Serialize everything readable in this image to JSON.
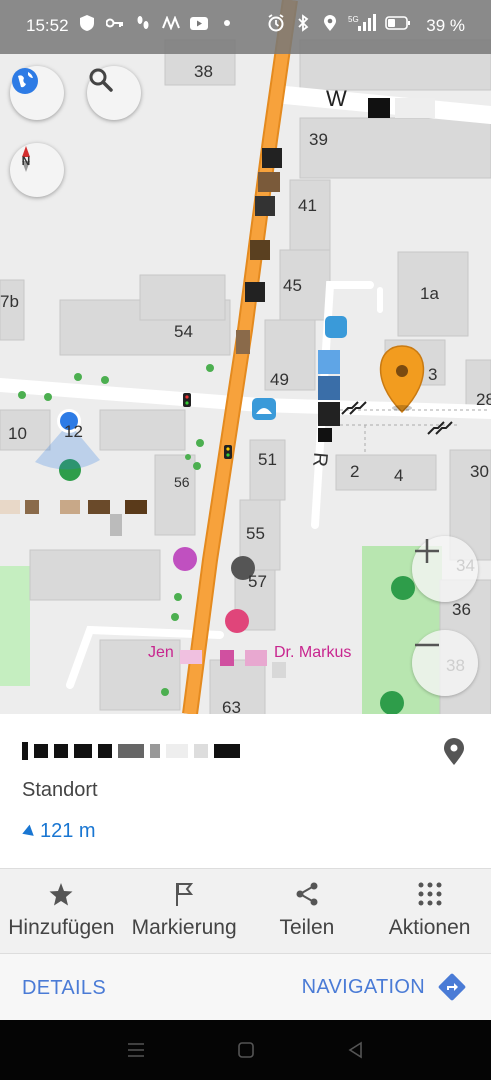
{
  "status_bar": {
    "time": "15:52",
    "battery_percent": "39 %",
    "network": "5G",
    "left_icons": [
      "shield-icon",
      "key-icon",
      "footsteps-icon",
      "wave-icon",
      "youtube-icon",
      "dot-icon"
    ],
    "right_icons": [
      "alarm-icon",
      "bluetooth-icon",
      "location-icon",
      "signal-icon",
      "battery-icon"
    ]
  },
  "map": {
    "building_numbers": [
      "38",
      "39",
      "41",
      "45",
      "54",
      "49",
      "1a",
      "3",
      "28",
      "7b",
      "10",
      "12",
      "51",
      "56",
      "2",
      "4",
      "30",
      "34",
      "55",
      "57",
      "36",
      "38",
      "63"
    ],
    "street_label_partial": "W",
    "street_label_vertical": "R",
    "poi_label_partial": "Jen",
    "poi_label_partial_2": "Dr. Markus",
    "colors": {
      "main_road": "#f7a23c",
      "background": "#ededed",
      "building": "#d9d9d9",
      "park": "#b8e6b0",
      "marker": "#f29c1f",
      "location_dot": "#2d7be5"
    }
  },
  "controls": {
    "layers_icon": "globe-icon",
    "search_icon": "search-icon",
    "compass_icon": "compass-icon",
    "zoom_in_icon": "plus-icon",
    "zoom_out_icon": "minus-icon"
  },
  "place_sheet": {
    "type": "Standort",
    "distance": "121 m",
    "pin_icon": "map-pin-icon"
  },
  "actions": [
    {
      "label": "Hinzufügen",
      "icon": "star-icon"
    },
    {
      "label": "Markierung",
      "icon": "flag-icon"
    },
    {
      "label": "Teilen",
      "icon": "share-icon"
    },
    {
      "label": "Aktionen",
      "icon": "grid-dots-icon"
    }
  ],
  "bottom": {
    "details_label": "DETAILS",
    "navigation_label": "NAVIGATION",
    "navigation_icon": "directions-icon"
  },
  "system_nav": [
    "recents-icon",
    "home-icon",
    "back-icon"
  ]
}
